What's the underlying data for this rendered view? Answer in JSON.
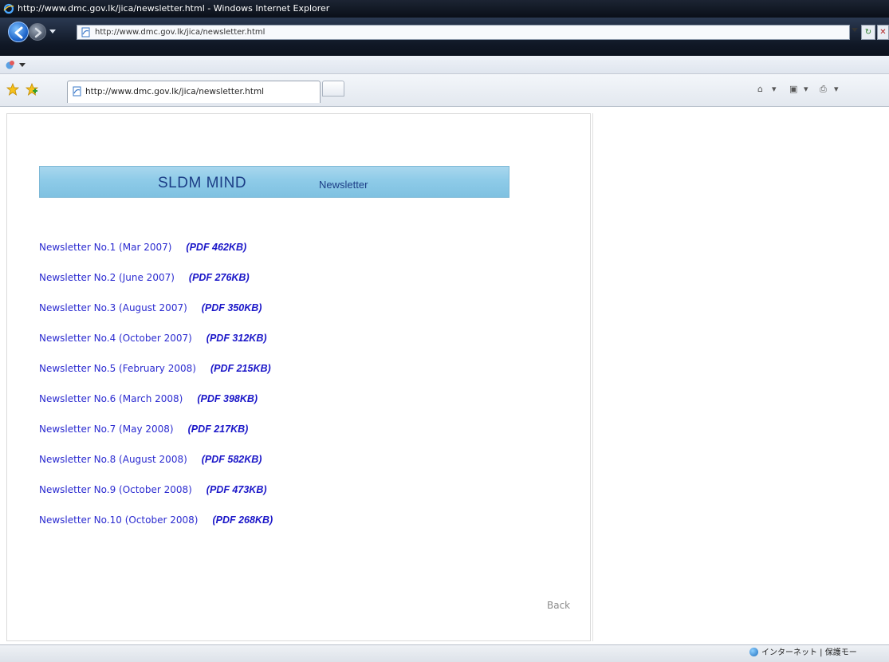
{
  "window": {
    "title": "http://www.dmc.gov.lk/jica/newsletter.html - Windows Internet Explorer"
  },
  "address_bar": {
    "url": "http://www.dmc.gov.lk/jica/newsletter.html"
  },
  "tab": {
    "label": "http://www.dmc.gov.lk/jica/newsletter.html"
  },
  "banner": {
    "title": "SLDM MIND",
    "subtitle": "Newsletter"
  },
  "newsletters": [
    {
      "title": "Newsletter No.1 (Mar 2007)",
      "pdf": "(PDF 462KB)"
    },
    {
      "title": "Newsletter No.2 (June 2007)",
      "pdf": "(PDF 276KB)"
    },
    {
      "title": "Newsletter No.3 (August 2007)",
      "pdf": "(PDF 350KB)"
    },
    {
      "title": "Newsletter No.4 (October 2007)",
      "pdf": "(PDF 312KB)"
    },
    {
      "title": "Newsletter No.5 (February 2008)",
      "pdf": "(PDF 215KB)"
    },
    {
      "title": "Newsletter No.6 (March 2008)",
      "pdf": "(PDF 398KB)"
    },
    {
      "title": "Newsletter No.7 (May 2008)",
      "pdf": "(PDF 217KB)"
    },
    {
      "title": "Newsletter No.8 (August 2008)",
      "pdf": "(PDF 582KB)"
    },
    {
      "title": "Newsletter No.9 (October 2008)",
      "pdf": "(PDF 473KB)"
    },
    {
      "title": "Newsletter No.10 (October 2008)",
      "pdf": "(PDF 268KB)"
    }
  ],
  "back_link": "Back",
  "status_bar": {
    "zone": "インターネット | 保護モー"
  },
  "colors": {
    "banner": "#8ecbe8",
    "link": "#2b2bd0",
    "pdf_link": "#1a16c8"
  },
  "icons": [
    "ie-logo-icon",
    "back-arrow-icon",
    "forward-arrow-icon",
    "page-icon",
    "favorites-star-icon",
    "add-favorites-icon",
    "home-icon",
    "feeds-icon",
    "print-icon",
    "globe-icon"
  ]
}
